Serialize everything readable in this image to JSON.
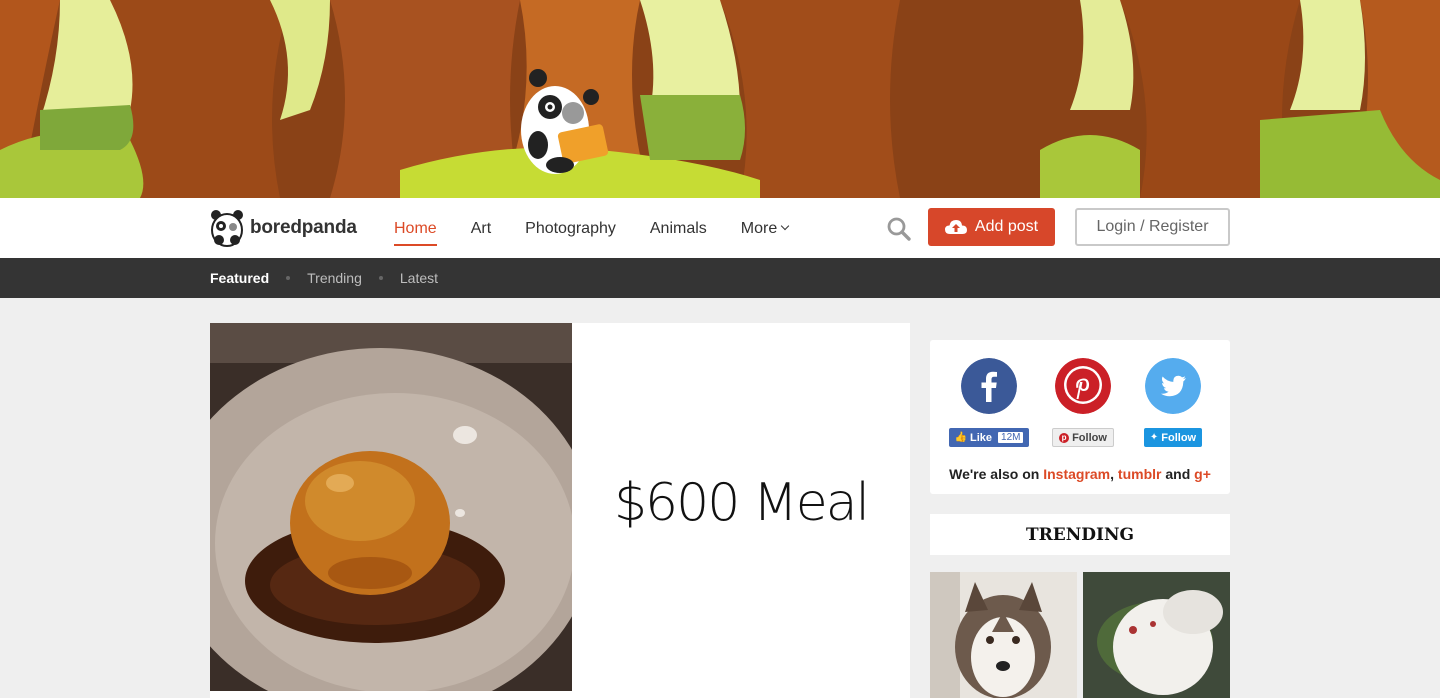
{
  "site": {
    "logo_text": "boredpanda"
  },
  "nav": {
    "items": [
      {
        "label": "Home",
        "active": true
      },
      {
        "label": "Art",
        "active": false
      },
      {
        "label": "Photography",
        "active": false
      },
      {
        "label": "Animals",
        "active": false
      },
      {
        "label": "More",
        "active": false
      }
    ],
    "add_post_label": "Add post",
    "login_label": "Login / Register"
  },
  "subnav": {
    "items": [
      {
        "label": "Featured",
        "active": true
      },
      {
        "label": "Trending",
        "active": false
      },
      {
        "label": "Latest",
        "active": false
      }
    ]
  },
  "featured": {
    "title": "$600 Meal"
  },
  "social": {
    "facebook": {
      "label": "Like",
      "count": "12M"
    },
    "pinterest": {
      "label": "Follow"
    },
    "twitter": {
      "label": "Follow"
    },
    "also_prefix": "We're also on ",
    "instagram": "Instagram",
    "comma": ", ",
    "tumblr": "tumblr",
    "and": " and ",
    "gplus": "g+"
  },
  "trending": {
    "title": "TRENDING"
  },
  "colors": {
    "accent": "#dc4a26",
    "subnav_bg": "#343434",
    "facebook": "#3b5998",
    "pinterest": "#cb2027",
    "twitter": "#55acee"
  }
}
